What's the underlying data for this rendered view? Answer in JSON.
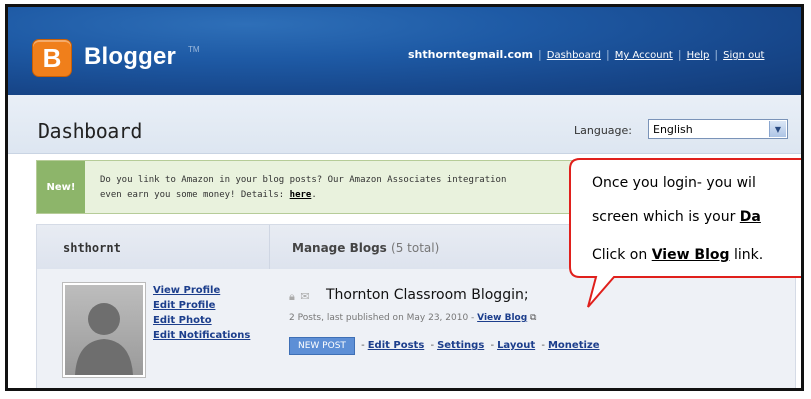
{
  "header": {
    "logo_letter": "B",
    "brand": "Blogger",
    "brand_tm": "TM",
    "email": "shthorntegmail.com",
    "nav": [
      "Dashboard",
      "My Account",
      "Help",
      "Sign out"
    ]
  },
  "dashbar": {
    "title": "Dashboard",
    "language_label": "Language:",
    "language_value": "English"
  },
  "promo": {
    "badge": "New!",
    "text_line1": "Do you link to Amazon in your blog posts? Our Amazon Associates integration",
    "text_line2_prefix": "even earn you some money! Details: ",
    "details_link": "here",
    "text_line2_suffix": "."
  },
  "profile": {
    "username": "shthornt",
    "links": [
      "View Profile",
      "Edit Profile",
      "Edit Photo",
      "Edit Notifications"
    ]
  },
  "blogs": {
    "heading": "Manage Blogs",
    "count": "(5 total)",
    "blog_name": "Thornton Classroom Bloggin;",
    "meta_prefix": "2 Posts, last published on May 23, 2010 - ",
    "view_blog": "View Blog",
    "new_post": "NEW POST",
    "actions": [
      "Edit Posts",
      "Settings",
      "Layout",
      "Monetize"
    ]
  },
  "callout": {
    "line1": "Once you login- you wil",
    "line2_prefix": "screen which is your  ",
    "line2_link": "Da",
    "line3_prefix": "Click on ",
    "line3_link": "View Blog",
    "line3_suffix": " link."
  },
  "colors": {
    "header_blue": "#1e5aa5",
    "logo_orange": "#f07f1b",
    "link_blue": "#1c3e8c",
    "promo_green": "#8db56a",
    "callout_border": "#e0201c"
  }
}
